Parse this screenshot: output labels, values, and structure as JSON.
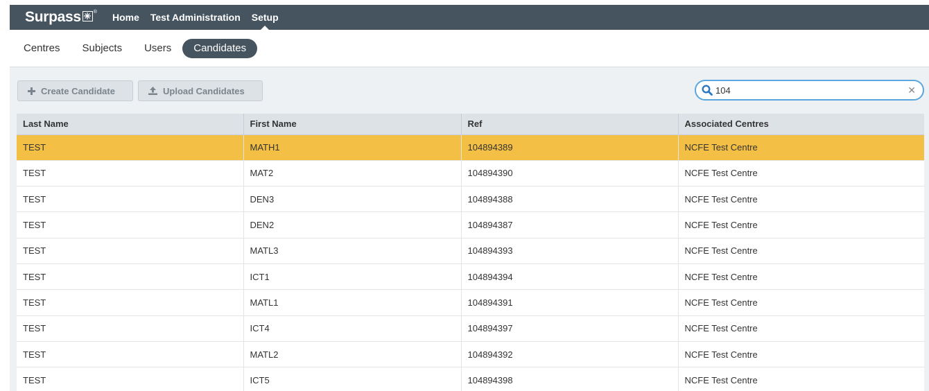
{
  "header": {
    "brand": "Surpass",
    "nav": [
      {
        "label": "Home",
        "active": false
      },
      {
        "label": "Test Administration",
        "active": false
      },
      {
        "label": "Setup",
        "active": true
      }
    ]
  },
  "subnav": {
    "items": [
      {
        "label": "Centres",
        "active": false
      },
      {
        "label": "Subjects",
        "active": false
      },
      {
        "label": "Users",
        "active": false
      },
      {
        "label": "Candidates",
        "active": true
      }
    ]
  },
  "toolbar": {
    "create_label": "Create Candidate",
    "create_icon": "plus-icon",
    "upload_label": "Upload Candidates",
    "upload_icon": "upload-icon"
  },
  "search": {
    "value": "104",
    "icon": "search-icon",
    "clear_icon": "close-icon"
  },
  "table": {
    "columns": [
      "Last Name",
      "First Name",
      "Ref",
      "Associated Centres"
    ],
    "rows": [
      {
        "last": "TEST",
        "first": "MATH1",
        "ref": "104894389",
        "centre": "NCFE Test Centre",
        "selected": true
      },
      {
        "last": "TEST",
        "first": "MAT2",
        "ref": "104894390",
        "centre": "NCFE Test Centre",
        "selected": false
      },
      {
        "last": "TEST",
        "first": "DEN3",
        "ref": "104894388",
        "centre": "NCFE Test Centre",
        "selected": false
      },
      {
        "last": "TEST",
        "first": "DEN2",
        "ref": "104894387",
        "centre": "NCFE Test Centre",
        "selected": false
      },
      {
        "last": "TEST",
        "first": "MATL3",
        "ref": "104894393",
        "centre": "NCFE Test Centre",
        "selected": false
      },
      {
        "last": "TEST",
        "first": "ICT1",
        "ref": "104894394",
        "centre": "NCFE Test Centre",
        "selected": false
      },
      {
        "last": "TEST",
        "first": "MATL1",
        "ref": "104894391",
        "centre": "NCFE Test Centre",
        "selected": false
      },
      {
        "last": "TEST",
        "first": "ICT4",
        "ref": "104894397",
        "centre": "NCFE Test Centre",
        "selected": false
      },
      {
        "last": "TEST",
        "first": "MATL2",
        "ref": "104894392",
        "centre": "NCFE Test Centre",
        "selected": false
      },
      {
        "last": "TEST",
        "first": "ICT5",
        "ref": "104894398",
        "centre": "NCFE Test Centre",
        "selected": false
      }
    ]
  },
  "colors": {
    "header_bg": "#465460",
    "selected_row": "#f3bf45",
    "search_border": "#5aa7e0",
    "search_icon": "#2a78c2"
  }
}
